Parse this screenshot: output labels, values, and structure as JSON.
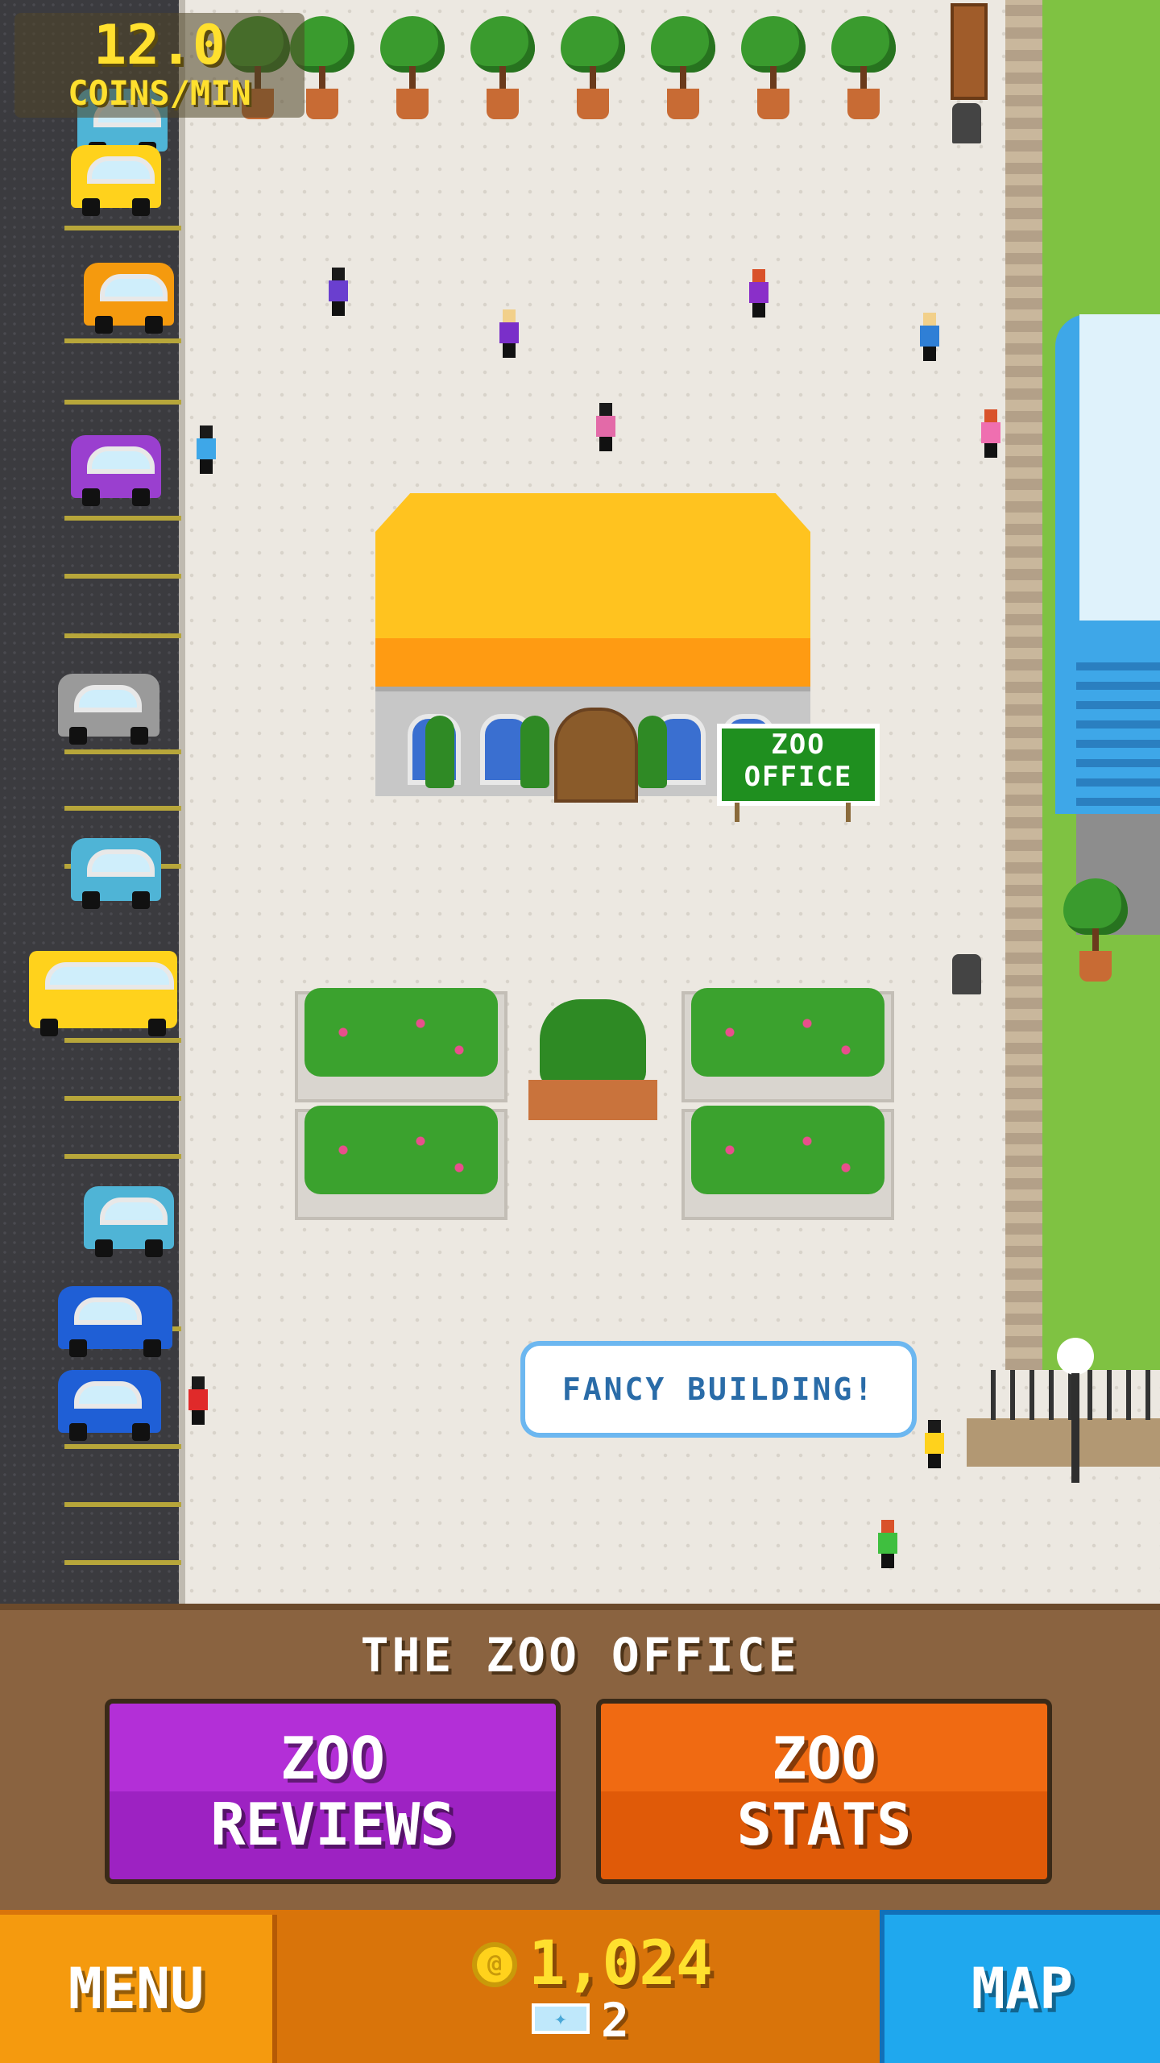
{
  "hud": {
    "rate_value": "12.0",
    "rate_unit": "COINS/MIN"
  },
  "scene": {
    "building_sign": "ZOO\nOFFICE",
    "speech_bubble": "FANCY BUILDING!"
  },
  "panel": {
    "title": "THE ZOO OFFICE",
    "reviews_button": "ZOO\nREVIEWS",
    "stats_button": "ZOO\nSTATS"
  },
  "bottom_bar": {
    "menu_label": "MENU",
    "map_label": "MAP",
    "coins": "1,024",
    "tickets": "2"
  },
  "colors": {
    "coin_yellow": "#ffe02e",
    "reviews_purple": "#b32fd7",
    "stats_orange": "#f06a12",
    "menu_orange": "#f59a0e",
    "map_blue": "#1fa8ee"
  },
  "icons": [
    "coin-icon",
    "ticket-icon"
  ]
}
